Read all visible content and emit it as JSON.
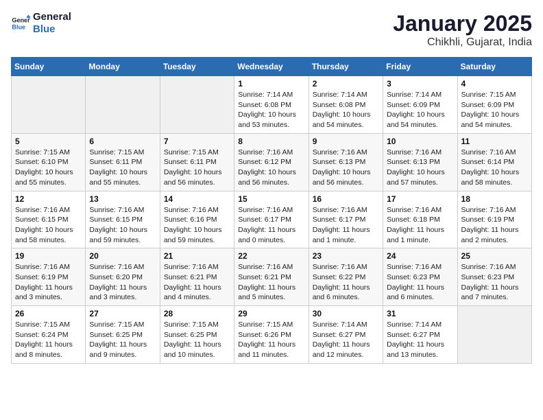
{
  "logo": {
    "line1": "General",
    "line2": "Blue"
  },
  "title": "January 2025",
  "subtitle": "Chikhli, Gujarat, India",
  "days_of_week": [
    "Sunday",
    "Monday",
    "Tuesday",
    "Wednesday",
    "Thursday",
    "Friday",
    "Saturday"
  ],
  "weeks": [
    [
      {
        "day": "",
        "info": ""
      },
      {
        "day": "",
        "info": ""
      },
      {
        "day": "",
        "info": ""
      },
      {
        "day": "1",
        "info": "Sunrise: 7:14 AM\nSunset: 6:08 PM\nDaylight: 10 hours\nand 53 minutes."
      },
      {
        "day": "2",
        "info": "Sunrise: 7:14 AM\nSunset: 6:08 PM\nDaylight: 10 hours\nand 54 minutes."
      },
      {
        "day": "3",
        "info": "Sunrise: 7:14 AM\nSunset: 6:09 PM\nDaylight: 10 hours\nand 54 minutes."
      },
      {
        "day": "4",
        "info": "Sunrise: 7:15 AM\nSunset: 6:09 PM\nDaylight: 10 hours\nand 54 minutes."
      }
    ],
    [
      {
        "day": "5",
        "info": "Sunrise: 7:15 AM\nSunset: 6:10 PM\nDaylight: 10 hours\nand 55 minutes."
      },
      {
        "day": "6",
        "info": "Sunrise: 7:15 AM\nSunset: 6:11 PM\nDaylight: 10 hours\nand 55 minutes."
      },
      {
        "day": "7",
        "info": "Sunrise: 7:15 AM\nSunset: 6:11 PM\nDaylight: 10 hours\nand 56 minutes."
      },
      {
        "day": "8",
        "info": "Sunrise: 7:16 AM\nSunset: 6:12 PM\nDaylight: 10 hours\nand 56 minutes."
      },
      {
        "day": "9",
        "info": "Sunrise: 7:16 AM\nSunset: 6:13 PM\nDaylight: 10 hours\nand 56 minutes."
      },
      {
        "day": "10",
        "info": "Sunrise: 7:16 AM\nSunset: 6:13 PM\nDaylight: 10 hours\nand 57 minutes."
      },
      {
        "day": "11",
        "info": "Sunrise: 7:16 AM\nSunset: 6:14 PM\nDaylight: 10 hours\nand 58 minutes."
      }
    ],
    [
      {
        "day": "12",
        "info": "Sunrise: 7:16 AM\nSunset: 6:15 PM\nDaylight: 10 hours\nand 58 minutes."
      },
      {
        "day": "13",
        "info": "Sunrise: 7:16 AM\nSunset: 6:15 PM\nDaylight: 10 hours\nand 59 minutes."
      },
      {
        "day": "14",
        "info": "Sunrise: 7:16 AM\nSunset: 6:16 PM\nDaylight: 10 hours\nand 59 minutes."
      },
      {
        "day": "15",
        "info": "Sunrise: 7:16 AM\nSunset: 6:17 PM\nDaylight: 11 hours\nand 0 minutes."
      },
      {
        "day": "16",
        "info": "Sunrise: 7:16 AM\nSunset: 6:17 PM\nDaylight: 11 hours\nand 1 minute."
      },
      {
        "day": "17",
        "info": "Sunrise: 7:16 AM\nSunset: 6:18 PM\nDaylight: 11 hours\nand 1 minute."
      },
      {
        "day": "18",
        "info": "Sunrise: 7:16 AM\nSunset: 6:19 PM\nDaylight: 11 hours\nand 2 minutes."
      }
    ],
    [
      {
        "day": "19",
        "info": "Sunrise: 7:16 AM\nSunset: 6:19 PM\nDaylight: 11 hours\nand 3 minutes."
      },
      {
        "day": "20",
        "info": "Sunrise: 7:16 AM\nSunset: 6:20 PM\nDaylight: 11 hours\nand 3 minutes."
      },
      {
        "day": "21",
        "info": "Sunrise: 7:16 AM\nSunset: 6:21 PM\nDaylight: 11 hours\nand 4 minutes."
      },
      {
        "day": "22",
        "info": "Sunrise: 7:16 AM\nSunset: 6:21 PM\nDaylight: 11 hours\nand 5 minutes."
      },
      {
        "day": "23",
        "info": "Sunrise: 7:16 AM\nSunset: 6:22 PM\nDaylight: 11 hours\nand 6 minutes."
      },
      {
        "day": "24",
        "info": "Sunrise: 7:16 AM\nSunset: 6:23 PM\nDaylight: 11 hours\nand 6 minutes."
      },
      {
        "day": "25",
        "info": "Sunrise: 7:16 AM\nSunset: 6:23 PM\nDaylight: 11 hours\nand 7 minutes."
      }
    ],
    [
      {
        "day": "26",
        "info": "Sunrise: 7:15 AM\nSunset: 6:24 PM\nDaylight: 11 hours\nand 8 minutes."
      },
      {
        "day": "27",
        "info": "Sunrise: 7:15 AM\nSunset: 6:25 PM\nDaylight: 11 hours\nand 9 minutes."
      },
      {
        "day": "28",
        "info": "Sunrise: 7:15 AM\nSunset: 6:25 PM\nDaylight: 11 hours\nand 10 minutes."
      },
      {
        "day": "29",
        "info": "Sunrise: 7:15 AM\nSunset: 6:26 PM\nDaylight: 11 hours\nand 11 minutes."
      },
      {
        "day": "30",
        "info": "Sunrise: 7:14 AM\nSunset: 6:27 PM\nDaylight: 11 hours\nand 12 minutes."
      },
      {
        "day": "31",
        "info": "Sunrise: 7:14 AM\nSunset: 6:27 PM\nDaylight: 11 hours\nand 13 minutes."
      },
      {
        "day": "",
        "info": ""
      }
    ]
  ]
}
